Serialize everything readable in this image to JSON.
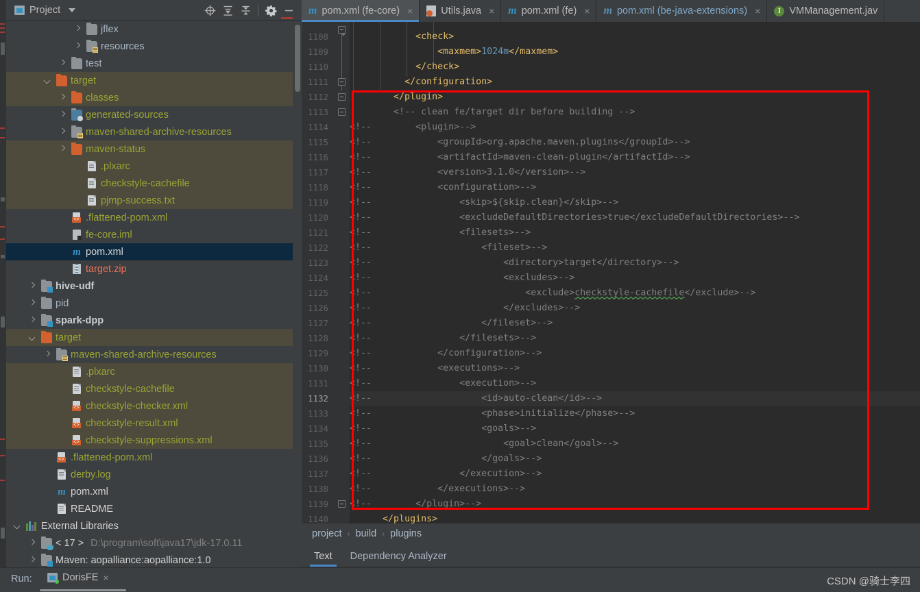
{
  "project_panel": {
    "title": "Project",
    "icons": [
      "project-icon",
      "chevron-down-icon",
      "locate-icon",
      "expand-all-icon",
      "collapse-all-icon",
      "gear-icon",
      "minimize-icon"
    ],
    "tree": [
      {
        "label": "jflex",
        "indent": 4,
        "arrow": "right",
        "icon": "folder",
        "color": "grey"
      },
      {
        "label": "resources",
        "indent": 4,
        "arrow": "right",
        "icon": "folder-resources",
        "color": "grey"
      },
      {
        "label": "test",
        "indent": 3,
        "arrow": "right",
        "icon": "folder",
        "color": "grey"
      },
      {
        "label": "target",
        "indent": 2,
        "arrow": "down",
        "icon": "folder-orange",
        "color": "olive",
        "highlight": "olive"
      },
      {
        "label": "classes",
        "indent": 3,
        "arrow": "right",
        "icon": "folder-orange",
        "color": "olive",
        "highlight": "olive"
      },
      {
        "label": "generated-sources",
        "indent": 3,
        "arrow": "right",
        "icon": "folder-generated",
        "color": "olive"
      },
      {
        "label": "maven-shared-archive-resources",
        "indent": 3,
        "arrow": "right",
        "icon": "folder-resources",
        "color": "olive"
      },
      {
        "label": "maven-status",
        "indent": 3,
        "arrow": "right",
        "icon": "folder-orange",
        "color": "olive",
        "highlight": "olive"
      },
      {
        "label": ".plxarc",
        "indent": 4,
        "arrow": "none",
        "icon": "file",
        "color": "olive",
        "highlight": "olive"
      },
      {
        "label": "checkstyle-cachefile",
        "indent": 4,
        "arrow": "none",
        "icon": "file",
        "color": "olive",
        "highlight": "olive"
      },
      {
        "label": "pjmp-success.txt",
        "indent": 4,
        "arrow": "none",
        "icon": "file",
        "color": "olive",
        "highlight": "olive"
      },
      {
        "label": ".flattened-pom.xml",
        "indent": 3,
        "arrow": "none",
        "icon": "xml",
        "color": "olive"
      },
      {
        "label": "fe-core.iml",
        "indent": 3,
        "arrow": "none",
        "icon": "iml",
        "color": "olive"
      },
      {
        "label": "pom.xml",
        "indent": 3,
        "arrow": "none",
        "icon": "maven",
        "color": "white",
        "highlight": "selected"
      },
      {
        "label": "target.zip",
        "indent": 3,
        "arrow": "none",
        "icon": "zip",
        "color": "red"
      },
      {
        "label": "hive-udf",
        "indent": 1,
        "arrow": "right",
        "icon": "folder-module",
        "color": "bold"
      },
      {
        "label": "pid",
        "indent": 1,
        "arrow": "right",
        "icon": "folder",
        "color": "grey"
      },
      {
        "label": "spark-dpp",
        "indent": 1,
        "arrow": "right",
        "icon": "folder-module",
        "color": "bold"
      },
      {
        "label": "target",
        "indent": 1,
        "arrow": "down",
        "icon": "folder-orange",
        "color": "olive",
        "highlight": "olive"
      },
      {
        "label": "maven-shared-archive-resources",
        "indent": 2,
        "arrow": "right",
        "icon": "folder-resources",
        "color": "olive"
      },
      {
        "label": ".plxarc",
        "indent": 3,
        "arrow": "none",
        "icon": "file",
        "color": "olive",
        "highlight": "olive"
      },
      {
        "label": "checkstyle-cachefile",
        "indent": 3,
        "arrow": "none",
        "icon": "file",
        "color": "olive",
        "highlight": "olive"
      },
      {
        "label": "checkstyle-checker.xml",
        "indent": 3,
        "arrow": "none",
        "icon": "xml",
        "color": "olive",
        "highlight": "olive"
      },
      {
        "label": "checkstyle-result.xml",
        "indent": 3,
        "arrow": "none",
        "icon": "xml",
        "color": "olive",
        "highlight": "olive"
      },
      {
        "label": "checkstyle-suppressions.xml",
        "indent": 3,
        "arrow": "none",
        "icon": "xml",
        "color": "olive",
        "highlight": "olive"
      },
      {
        "label": ".flattened-pom.xml",
        "indent": 2,
        "arrow": "none",
        "icon": "xml",
        "color": "olive"
      },
      {
        "label": "derby.log",
        "indent": 2,
        "arrow": "none",
        "icon": "file",
        "color": "olive"
      },
      {
        "label": "pom.xml",
        "indent": 2,
        "arrow": "none",
        "icon": "maven",
        "color": "white"
      },
      {
        "label": "README",
        "indent": 2,
        "arrow": "none",
        "icon": "file",
        "color": "white"
      },
      {
        "label": "External Libraries",
        "indent": 0,
        "arrow": "down",
        "icon": "libraries",
        "color": "white"
      },
      {
        "label": "< 17 >",
        "sublabel": "D:\\program\\soft\\java17\\jdk-17.0.11",
        "indent": 1,
        "arrow": "right",
        "icon": "jdk",
        "color": "white"
      },
      {
        "label": "Maven: aopalliance:aopalliance:1.0",
        "indent": 1,
        "arrow": "right",
        "icon": "folder-lib",
        "color": "white"
      }
    ]
  },
  "editor": {
    "tabs": [
      {
        "label": "pom.xml (fe-core)",
        "icon": "maven-icon",
        "active": true,
        "closable": true
      },
      {
        "label": "Utils.java",
        "icon": "java-icon",
        "active": false,
        "closable": true
      },
      {
        "label": "pom.xml (fe)",
        "icon": "maven-icon",
        "active": false,
        "closable": true
      },
      {
        "label": "pom.xml (be-java-extensions)",
        "icon": "maven-icon",
        "active": false,
        "closable": true
      },
      {
        "label": "VMManagement.jav",
        "icon": "interface-icon",
        "active": false,
        "closable": false
      }
    ],
    "first_line_number": 1108,
    "current_line": 1132,
    "lines": [
      {
        "n": 1108,
        "indent": 12,
        "segments": [
          {
            "t": "<check>",
            "c": "tag"
          }
        ]
      },
      {
        "n": 1109,
        "indent": 16,
        "segments": [
          {
            "t": "<maxmem>",
            "c": "tag"
          },
          {
            "t": "1024m",
            "c": "num"
          },
          {
            "t": "</maxmem>",
            "c": "tag"
          }
        ]
      },
      {
        "n": 1110,
        "indent": 12,
        "segments": [
          {
            "t": "</check>",
            "c": "tag"
          }
        ]
      },
      {
        "n": 1111,
        "indent": 10,
        "segments": [
          {
            "t": "</configuration>",
            "c": "tag"
          }
        ]
      },
      {
        "n": 1112,
        "indent": 8,
        "segments": [
          {
            "t": "</plugin>",
            "c": "tag"
          }
        ]
      },
      {
        "n": 1113,
        "indent": 8,
        "segments": [
          {
            "t": "<!-- clean fe/target dir before building -->",
            "c": "cmt"
          }
        ]
      },
      {
        "n": 1114,
        "indent": 0,
        "segments": [
          {
            "t": "<!--",
            "c": "cmt"
          },
          {
            "t": "        <plugin>-->",
            "c": "cmt"
          }
        ]
      },
      {
        "n": 1115,
        "indent": 0,
        "segments": [
          {
            "t": "<!--",
            "c": "cmt"
          },
          {
            "t": "            <groupId>org.apache.maven.plugins</groupId>-->",
            "c": "cmt"
          }
        ]
      },
      {
        "n": 1116,
        "indent": 0,
        "segments": [
          {
            "t": "<!--",
            "c": "cmt"
          },
          {
            "t": "            <artifactId>maven-clean-plugin</artifactId>-->",
            "c": "cmt"
          }
        ]
      },
      {
        "n": 1117,
        "indent": 0,
        "segments": [
          {
            "t": "<!--",
            "c": "cmt"
          },
          {
            "t": "            <version>3.1.0</version>-->",
            "c": "cmt"
          }
        ]
      },
      {
        "n": 1118,
        "indent": 0,
        "segments": [
          {
            "t": "<!--",
            "c": "cmt"
          },
          {
            "t": "            <configuration>-->",
            "c": "cmt"
          }
        ]
      },
      {
        "n": 1119,
        "indent": 0,
        "segments": [
          {
            "t": "<!--",
            "c": "cmt"
          },
          {
            "t": "                <skip>${skip.clean}</skip>-->",
            "c": "cmt"
          }
        ]
      },
      {
        "n": 1120,
        "indent": 0,
        "segments": [
          {
            "t": "<!--",
            "c": "cmt"
          },
          {
            "t": "                <excludeDefaultDirectories>true</excludeDefaultDirectories>-->",
            "c": "cmt"
          }
        ]
      },
      {
        "n": 1121,
        "indent": 0,
        "segments": [
          {
            "t": "<!--",
            "c": "cmt"
          },
          {
            "t": "                <filesets>-->",
            "c": "cmt"
          }
        ]
      },
      {
        "n": 1122,
        "indent": 0,
        "segments": [
          {
            "t": "<!--",
            "c": "cmt"
          },
          {
            "t": "                    <fileset>-->",
            "c": "cmt"
          }
        ]
      },
      {
        "n": 1123,
        "indent": 0,
        "segments": [
          {
            "t": "<!--",
            "c": "cmt"
          },
          {
            "t": "                        <directory>target</directory>-->",
            "c": "cmt"
          }
        ]
      },
      {
        "n": 1124,
        "indent": 0,
        "segments": [
          {
            "t": "<!--",
            "c": "cmt"
          },
          {
            "t": "                        <excludes>-->",
            "c": "cmt"
          }
        ]
      },
      {
        "n": 1125,
        "indent": 0,
        "segments": [
          {
            "t": "<!--",
            "c": "cmt"
          },
          {
            "t": "                            <exclude>",
            "c": "cmt"
          },
          {
            "t": "checkstyle-cachefile",
            "c": "cmt-squiggle"
          },
          {
            "t": "</exclude>-->",
            "c": "cmt"
          }
        ]
      },
      {
        "n": 1126,
        "indent": 0,
        "segments": [
          {
            "t": "<!--",
            "c": "cmt"
          },
          {
            "t": "                        </excludes>-->",
            "c": "cmt"
          }
        ]
      },
      {
        "n": 1127,
        "indent": 0,
        "segments": [
          {
            "t": "<!--",
            "c": "cmt"
          },
          {
            "t": "                    </fileset>-->",
            "c": "cmt"
          }
        ]
      },
      {
        "n": 1128,
        "indent": 0,
        "segments": [
          {
            "t": "<!--",
            "c": "cmt"
          },
          {
            "t": "                </filesets>-->",
            "c": "cmt"
          }
        ]
      },
      {
        "n": 1129,
        "indent": 0,
        "segments": [
          {
            "t": "<!--",
            "c": "cmt"
          },
          {
            "t": "            </configuration>-->",
            "c": "cmt"
          }
        ]
      },
      {
        "n": 1130,
        "indent": 0,
        "segments": [
          {
            "t": "<!--",
            "c": "cmt"
          },
          {
            "t": "            <executions>-->",
            "c": "cmt"
          }
        ]
      },
      {
        "n": 1131,
        "indent": 0,
        "segments": [
          {
            "t": "<!--",
            "c": "cmt"
          },
          {
            "t": "                <execution>-->",
            "c": "cmt"
          }
        ]
      },
      {
        "n": 1132,
        "indent": 0,
        "current": true,
        "segments": [
          {
            "t": "<!--",
            "c": "cmt"
          },
          {
            "t": "                    <id>auto-clean</id>-->",
            "c": "cmt"
          }
        ]
      },
      {
        "n": 1133,
        "indent": 0,
        "segments": [
          {
            "t": "<!--",
            "c": "cmt"
          },
          {
            "t": "                    <phase>initialize</phase>-->",
            "c": "cmt"
          }
        ]
      },
      {
        "n": 1134,
        "indent": 0,
        "segments": [
          {
            "t": "<!--",
            "c": "cmt"
          },
          {
            "t": "                    <goals>-->",
            "c": "cmt"
          }
        ]
      },
      {
        "n": 1135,
        "indent": 0,
        "segments": [
          {
            "t": "<!--",
            "c": "cmt"
          },
          {
            "t": "                        <goal>clean</goal>-->",
            "c": "cmt"
          }
        ]
      },
      {
        "n": 1136,
        "indent": 0,
        "segments": [
          {
            "t": "<!--",
            "c": "cmt"
          },
          {
            "t": "                    </goals>-->",
            "c": "cmt"
          }
        ]
      },
      {
        "n": 1137,
        "indent": 0,
        "segments": [
          {
            "t": "<!--",
            "c": "cmt"
          },
          {
            "t": "                </execution>-->",
            "c": "cmt"
          }
        ]
      },
      {
        "n": 1138,
        "indent": 0,
        "segments": [
          {
            "t": "<!--",
            "c": "cmt"
          },
          {
            "t": "            </executions>-->",
            "c": "cmt"
          }
        ]
      },
      {
        "n": 1139,
        "indent": 0,
        "segments": [
          {
            "t": "<!--",
            "c": "cmt"
          },
          {
            "t": "        </plugin>-->",
            "c": "cmt"
          }
        ]
      },
      {
        "n": 1140,
        "indent": 6,
        "segments": [
          {
            "t": "</plugins>",
            "c": "tag"
          }
        ]
      }
    ],
    "annotation": {
      "type": "red-rectangle",
      "color": "#ff0000"
    }
  },
  "breadcrumb": {
    "items": [
      "project",
      "build",
      "plugins"
    ],
    "separator": "›"
  },
  "editor_bottom_tabs": [
    {
      "label": "Text",
      "active": true
    },
    {
      "label": "Dependency Analyzer",
      "active": false
    }
  ],
  "statusbar": {
    "run_label": "Run:",
    "run_config": "DorisFE",
    "close": "×",
    "watermark": "CSDN @骑士李四"
  }
}
